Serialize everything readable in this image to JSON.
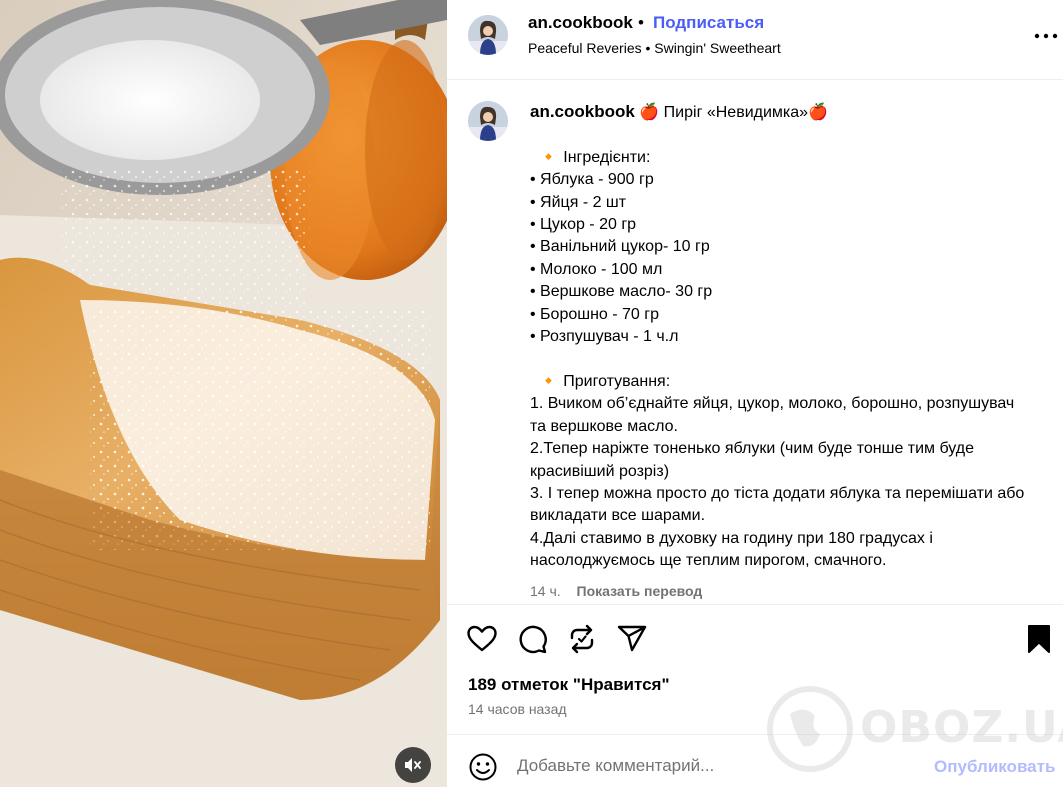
{
  "post": {
    "username": "an.cookbook",
    "follow_label": "Подписаться",
    "separator": "•",
    "music": "Peaceful Reveries • Swingin' Sweetheart"
  },
  "caption": {
    "username": "an.cookbook",
    "text": " 🍎 Пиріг «Невидимка»🍎\n\n  🔸 Інгредієнти:\n• Яблука - 900 гр\n• Яйця - 2 шт\n• Цукор - 20 гр\n• Ванільний цукор- 10 гр\n• Молоко - 100 мл\n• Вершкове масло- 30 гр\n• Борошно - 70 гр\n• Розпушувач - 1 ч.л\n\n  🔸 Приготування:\n1. Вчиком об’єднайте яйця, цукор, молоко, борошно, розпушувач та вершкове масло.\n2.Тепер наріжте тоненько яблуки (чим буде тонше тим буде красивіший розріз)\n3. І тепер можна просто до тіста додати яблука та перемішати або викладати все шарами.\n4.Далі ставимо в духовку на годину при 180 градусах і насолоджуємось ще теплим пирогом, смачного.",
    "age": "14 ч.",
    "translate_label": "Показать перевод"
  },
  "stats": {
    "likes": "189 отметок \"Нравится\"",
    "time_ago": "14 часов назад"
  },
  "comment": {
    "placeholder": "Добавьте комментарий...",
    "publish_label": "Опубликовать"
  },
  "watermark": "OBOZ.UA",
  "icons": {
    "more": "more-horizontal-icon",
    "like": "heart-icon",
    "comment": "comment-bubble-icon",
    "repost": "repost-icon",
    "share": "paper-plane-icon",
    "save": "bookmark-icon",
    "emoji": "emoji-smile-icon",
    "mute": "speaker-muted-icon"
  },
  "colors": {
    "link_blue": "#4a5df9",
    "publish_disabled": "#b3bbff",
    "secondary_text": "#737373",
    "divider": "#efefef"
  }
}
